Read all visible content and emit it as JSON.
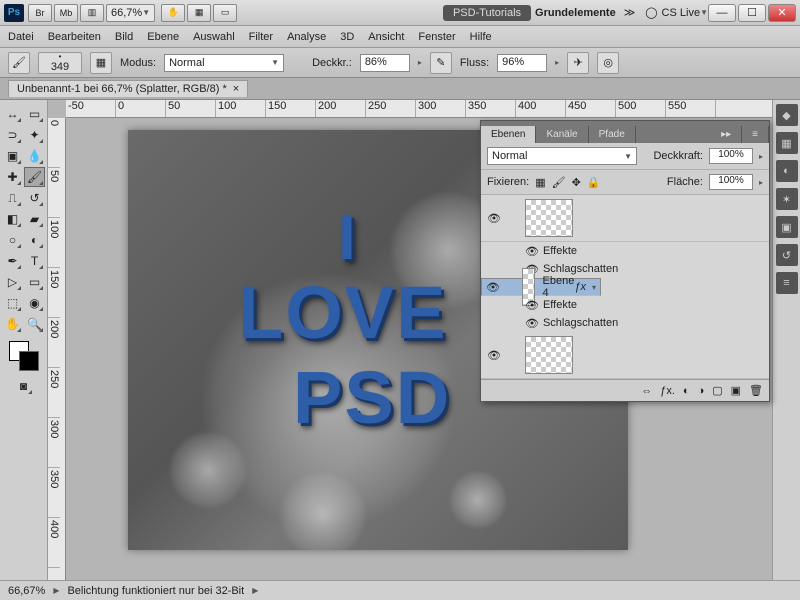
{
  "title": {
    "workspace": "PSD-Tutorials",
    "doc": "Grundelemente",
    "cslive": "CS Live"
  },
  "zoom_tb": "66,7%",
  "menu": [
    "Datei",
    "Bearbeiten",
    "Bild",
    "Ebene",
    "Auswahl",
    "Filter",
    "Analyse",
    "3D",
    "Ansicht",
    "Fenster",
    "Hilfe"
  ],
  "options": {
    "brush_size": "349",
    "mode_label": "Modus:",
    "mode_value": "Normal",
    "opacity_label": "Deckkr.:",
    "opacity_value": "86%",
    "flow_label": "Fluss:",
    "flow_value": "96%"
  },
  "doc_tab": "Unbenannt-1 bei 66,7% (Splatter, RGB/8) *",
  "ruler_h": [
    "-50",
    "0",
    "50",
    "100",
    "150",
    "200",
    "250",
    "300",
    "350",
    "400",
    "450",
    "500",
    "550"
  ],
  "ruler_v": [
    "0",
    "50",
    "100",
    "150",
    "200",
    "250",
    "300",
    "350",
    "400"
  ],
  "artwork": {
    "line1": "I",
    "line2": "LOVE",
    "line3": "PSD"
  },
  "panel": {
    "tabs": [
      "Ebenen",
      "Kanäle",
      "Pfade"
    ],
    "blend": "Normal",
    "opacity_label": "Deckkraft:",
    "opacity": "100%",
    "lock_label": "Fixieren:",
    "fill_label": "Fläche:",
    "fill": "100%",
    "layers": [
      {
        "name": "",
        "fx": true,
        "effects": [
          "Effekte",
          "Schlagschatten"
        ]
      },
      {
        "name": "Ebene 4",
        "fx": true,
        "selected": true,
        "effects": [
          "Effekte",
          "Schlagschatten"
        ]
      },
      {
        "name": "",
        "fx": false
      }
    ]
  },
  "status": {
    "zoom": "66,67%",
    "msg": "Belichtung funktioniert nur bei 32-Bit"
  }
}
